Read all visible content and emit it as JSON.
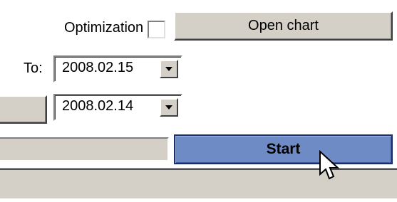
{
  "toolbar": {
    "optimization_label": "Optimization",
    "optimization_checked": false,
    "open_chart_label": "Open chart"
  },
  "date_range": {
    "to_label": "To:",
    "to_value": "2008.02.15",
    "from_value": "2008.02.14"
  },
  "actions": {
    "start_label": "Start"
  },
  "icons": {
    "dropdown": "chevron-down-icon",
    "cursor": "mouse-pointer-icon"
  },
  "colors": {
    "face": "#d4d0c8",
    "start_button": "#6f8bc6",
    "start_button_border": "#1b2f6a"
  }
}
